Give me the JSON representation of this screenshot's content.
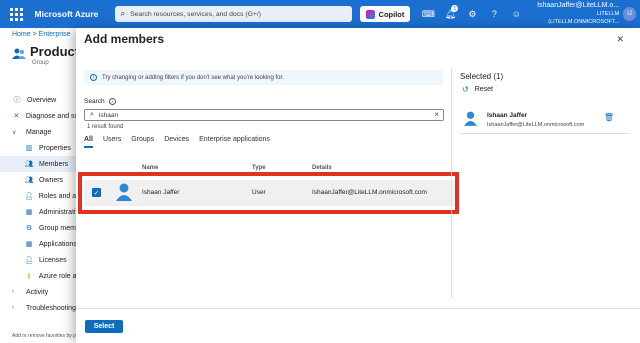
{
  "topbar": {
    "brand": "Microsoft Azure",
    "search_placeholder": "Search resources, services, and docs (G+/)",
    "copilot_label": "Copilot",
    "notification_count": "1",
    "account_name": "IshaanJaffer@LiteLLM.o...",
    "account_org": "LITELLM (LITELLM.ONMICROSOFT...",
    "icons": [
      "cloud-shell-icon",
      "bell-icon",
      "gear-icon",
      "help-icon",
      "feedback-icon"
    ]
  },
  "left": {
    "breadcrumb": "Home > Enterprise",
    "group_title": "Product",
    "group_subtitle": "Group",
    "nav": [
      {
        "label": "Overview",
        "level": "top",
        "icon": "info-icon"
      },
      {
        "label": "Diagnose and sol",
        "level": "top",
        "icon": "wrench-icon"
      },
      {
        "label": "Manage",
        "level": "top",
        "chevron": "down"
      },
      {
        "label": "Properties",
        "level": "sub",
        "icon": "properties-icon"
      },
      {
        "label": "Members",
        "level": "sub",
        "icon": "members-icon",
        "selected": true
      },
      {
        "label": "Owners",
        "level": "sub",
        "icon": "owners-icon"
      },
      {
        "label": "Roles and ad",
        "level": "sub",
        "icon": "roles-icon"
      },
      {
        "label": "Administrativ",
        "level": "sub",
        "icon": "admin-units-icon"
      },
      {
        "label": "Group memb",
        "level": "sub",
        "icon": "group-memberships-icon"
      },
      {
        "label": "Applications",
        "level": "sub",
        "icon": "applications-icon"
      },
      {
        "label": "Licenses",
        "level": "sub",
        "icon": "licenses-icon"
      },
      {
        "label": "Azure role as",
        "level": "sub",
        "icon": "key-icon"
      },
      {
        "label": "Activity",
        "level": "top",
        "chevron": "right"
      },
      {
        "label": "Troubleshooting",
        "level": "top",
        "chevron": "right"
      }
    ],
    "footer": "Add or remove favorites by p"
  },
  "panel": {
    "title": "Add members",
    "info_text": "Try changing or adding filters if you don't see what you're looking for.",
    "search_label": "Search",
    "search_value": "ishaan",
    "result_count": "1 result found",
    "tabs": [
      "All",
      "Users",
      "Groups",
      "Devices",
      "Enterprise applications"
    ],
    "active_tab": "All",
    "columns": [
      "Name",
      "Type",
      "Details"
    ],
    "rows": [
      {
        "name": "Ishaan Jaffer",
        "type": "User",
        "details": "IshaanJaffer@LiteLLM.onmicrosoft.com",
        "checked": true
      }
    ],
    "selected_title": "Selected (1)",
    "reset_label": "Reset",
    "selected_items": [
      {
        "name": "Ishaan Jaffer",
        "email": "IshaanJaffer@LiteLLM.onmicrosoft.com"
      }
    ],
    "select_button": "Select"
  },
  "colors": {
    "topbar": "#1a6fd0",
    "accent": "#0f6cbd",
    "highlight": "#e03123"
  }
}
